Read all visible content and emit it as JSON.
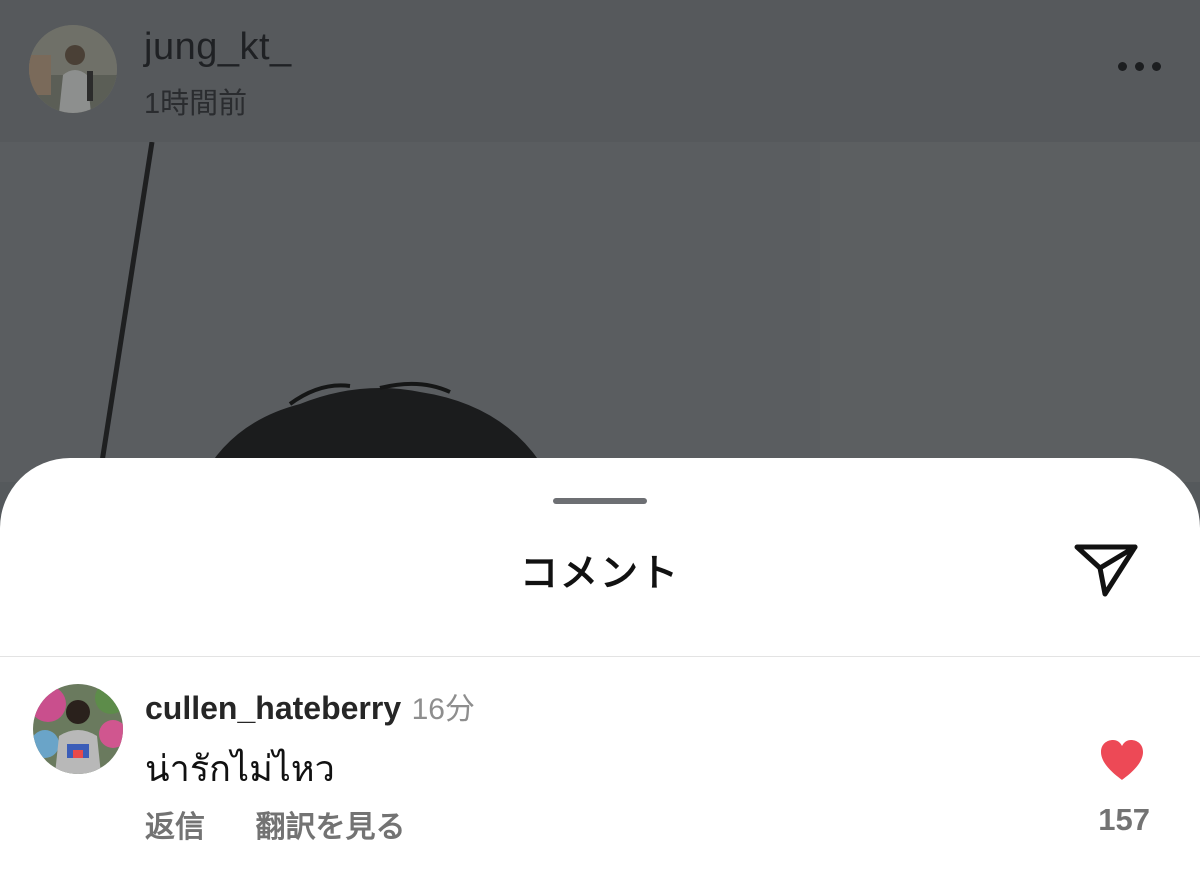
{
  "post": {
    "author": "jung_kt_",
    "time": "1時間前"
  },
  "sheet": {
    "title": "コメント"
  },
  "comment": {
    "username": "cullen_hateberry",
    "time": "16分",
    "text": "น่ารักไม่ไหว",
    "reply_label": "返信",
    "translate_label": "翻訳を見る",
    "like_count": "157"
  },
  "icons": {
    "more": "more-horizontal-icon",
    "share": "paper-plane-icon",
    "like": "heart-filled-icon"
  },
  "colors": {
    "like": "#ed4956",
    "sheet_background": "#ffffff",
    "dim_overlay": "#55595c"
  }
}
